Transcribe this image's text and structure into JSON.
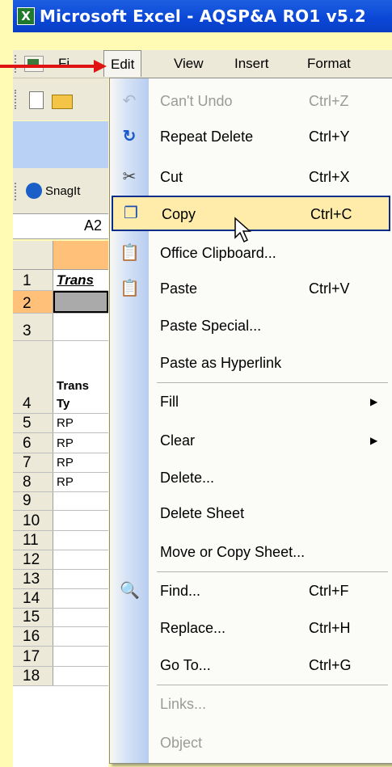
{
  "window": {
    "title": "Microsoft Excel - AQSP&A RO1 v5.2",
    "app_icon_letter": "X"
  },
  "menubar": {
    "items": [
      {
        "label": "File",
        "visible": "Fi"
      },
      {
        "label": "Edit"
      },
      {
        "label": "View"
      },
      {
        "label": "Insert"
      },
      {
        "label": "Format"
      }
    ]
  },
  "toolbar": {
    "snagit_label": "SnagIt"
  },
  "namebox": {
    "value": "A2"
  },
  "grid": {
    "rows": [
      {
        "num": "1",
        "a": "Trans"
      },
      {
        "num": "2",
        "a": ""
      },
      {
        "num": "3",
        "a": ""
      },
      {
        "num": "4",
        "a": "Trans\nTy"
      },
      {
        "num": "5",
        "a": "RP"
      },
      {
        "num": "6",
        "a": "RP"
      },
      {
        "num": "7",
        "a": "RP"
      },
      {
        "num": "8",
        "a": "RP"
      },
      {
        "num": "9",
        "a": ""
      },
      {
        "num": "10",
        "a": ""
      },
      {
        "num": "11",
        "a": ""
      },
      {
        "num": "12",
        "a": ""
      },
      {
        "num": "13",
        "a": ""
      },
      {
        "num": "14",
        "a": ""
      },
      {
        "num": "15",
        "a": ""
      },
      {
        "num": "16",
        "a": ""
      },
      {
        "num": "17",
        "a": ""
      },
      {
        "num": "18",
        "a": ""
      }
    ]
  },
  "edit_menu": {
    "items": [
      {
        "label": "Can't Undo",
        "shortcut": "Ctrl+Z",
        "icon": "undo-icon"
      },
      {
        "label": "Repeat Delete",
        "shortcut": "Ctrl+Y",
        "icon": "redo-icon"
      },
      {
        "label": "Cut",
        "shortcut": "Ctrl+X",
        "icon": "scissors-icon"
      },
      {
        "label": "Copy",
        "shortcut": "Ctrl+C",
        "icon": "copy-icon"
      },
      {
        "label": "Office Clipboard...",
        "shortcut": "",
        "icon": "clipboard-icon"
      },
      {
        "label": "Paste",
        "shortcut": "Ctrl+V",
        "icon": "paste-icon"
      },
      {
        "label": "Paste Special...",
        "shortcut": ""
      },
      {
        "label": "Paste as Hyperlink",
        "shortcut": ""
      },
      {
        "label": "Fill",
        "shortcut": ""
      },
      {
        "label": "Clear",
        "shortcut": ""
      },
      {
        "label": "Delete...",
        "shortcut": ""
      },
      {
        "label": "Delete Sheet",
        "shortcut": ""
      },
      {
        "label": "Move or Copy Sheet...",
        "shortcut": ""
      },
      {
        "label": "Find...",
        "shortcut": "Ctrl+F",
        "icon": "binoculars-icon"
      },
      {
        "label": "Replace...",
        "shortcut": "Ctrl+H"
      },
      {
        "label": "Go To...",
        "shortcut": "Ctrl+G"
      },
      {
        "label": "Links...",
        "shortcut": ""
      },
      {
        "label": "Object",
        "shortcut": ""
      }
    ]
  },
  "colors": {
    "background": "#fffbb5",
    "title_bar": "#0a46d6",
    "highlight": "#ffecab",
    "highlight_border": "#0b2d8a",
    "arrow": "#e01313",
    "selected_header": "#ffc079"
  }
}
